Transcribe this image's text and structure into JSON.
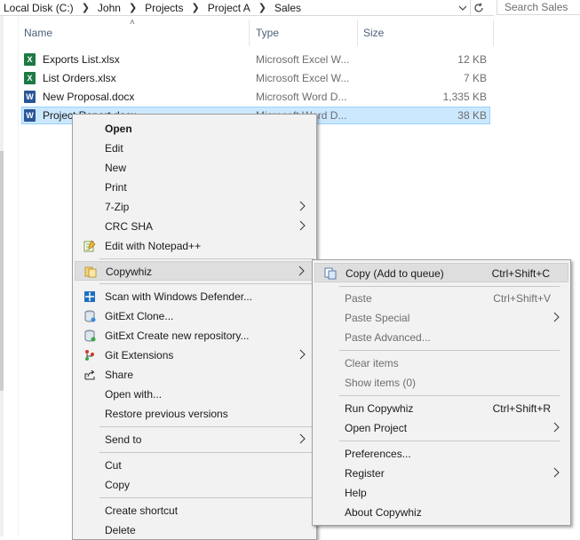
{
  "address": {
    "crumbs": [
      "Local Disk (C:)",
      "John",
      "Projects",
      "Project A",
      "Sales"
    ],
    "search_placeholder": "Search Sales"
  },
  "columns": {
    "name": "Name",
    "type": "Type",
    "size": "Size"
  },
  "files": [
    {
      "name": "Exports List.xlsx",
      "type": "Microsoft Excel W...",
      "size": "12 KB",
      "icon": "excel-file-icon",
      "badge": "X"
    },
    {
      "name": "List Orders.xlsx",
      "type": "Microsoft Excel W...",
      "size": "7 KB",
      "icon": "excel-file-icon",
      "badge": "X"
    },
    {
      "name": "New Proposal.docx",
      "type": "Microsoft Word D...",
      "size": "1,335 KB",
      "icon": "word-file-icon",
      "badge": "W"
    },
    {
      "name": "Project Report.docx",
      "type": "Microsoft Word D...",
      "size": "38 KB",
      "icon": "word-file-icon",
      "badge": "W",
      "selected": true
    }
  ],
  "context_menu": {
    "open": "Open",
    "edit": "Edit",
    "new": "New",
    "print": "Print",
    "zip": "7-Zip",
    "crc": "CRC SHA",
    "notepad": "Edit with Notepad++",
    "copywhiz": "Copywhiz",
    "defender": "Scan with Windows Defender...",
    "gitext_clone": "GitExt Clone...",
    "gitext_create": "GitExt Create new repository...",
    "git_extensions": "Git Extensions",
    "share": "Share",
    "open_with": "Open with...",
    "restore": "Restore previous versions",
    "send_to": "Send to",
    "cut": "Cut",
    "copy": "Copy",
    "create_shortcut": "Create shortcut",
    "delete": "Delete"
  },
  "copywhiz_menu": {
    "copy_add": "Copy (Add to queue)",
    "copy_add_sc": "Ctrl+Shift+C",
    "paste": "Paste",
    "paste_sc": "Ctrl+Shift+V",
    "paste_special": "Paste Special",
    "paste_advanced": "Paste Advanced...",
    "clear_items": "Clear items",
    "show_items": "Show items (0)",
    "run": "Run Copywhiz",
    "run_sc": "Ctrl+Shift+R",
    "open_project": "Open Project",
    "preferences": "Preferences...",
    "register": "Register",
    "help": "Help",
    "about": "About Copywhiz"
  }
}
